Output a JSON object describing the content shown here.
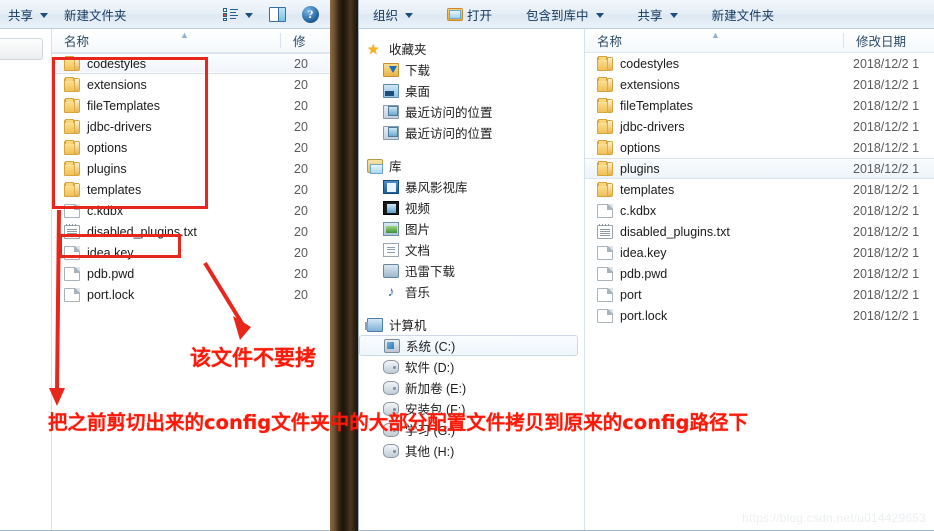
{
  "left_window": {
    "toolbar": {
      "share_label": "共享",
      "new_folder_label": "新建文件夹",
      "views_icon": "views-icon",
      "preview_pane_icon": "preview-pane-icon",
      "help_icon": "help-icon"
    },
    "columns": {
      "name": "名称",
      "date": "修"
    },
    "files": [
      {
        "name": "codestyles",
        "type": "folder",
        "date": "20",
        "state": "focus"
      },
      {
        "name": "extensions",
        "type": "folder",
        "date": "20",
        "state": ""
      },
      {
        "name": "fileTemplates",
        "type": "folder",
        "date": "20",
        "state": ""
      },
      {
        "name": "jdbc-drivers",
        "type": "folder",
        "date": "20",
        "state": ""
      },
      {
        "name": "options",
        "type": "folder",
        "date": "20",
        "state": ""
      },
      {
        "name": "plugins",
        "type": "folder",
        "date": "20",
        "state": ""
      },
      {
        "name": "templates",
        "type": "folder",
        "date": "20",
        "state": ""
      },
      {
        "name": "c.kdbx",
        "type": "file",
        "date": "20",
        "state": ""
      },
      {
        "name": "disabled_plugins.txt",
        "type": "txt",
        "date": "20",
        "state": ""
      },
      {
        "name": "idea.key",
        "type": "file",
        "date": "20",
        "state": ""
      },
      {
        "name": "pdb.pwd",
        "type": "file",
        "date": "20",
        "state": ""
      },
      {
        "name": "port.lock",
        "type": "file",
        "date": "20",
        "state": ""
      }
    ]
  },
  "right_window": {
    "toolbar": {
      "organize_label": "组织",
      "open_label": "打开",
      "include_in_library_label": "包含到库中",
      "share_label": "共享",
      "new_folder_label": "新建文件夹",
      "open_icon": "open-folder-icon"
    },
    "columns": {
      "name": "名称",
      "date": "修改日期"
    },
    "nav": [
      {
        "label": "收藏夹",
        "icon": "star-icon",
        "level": "head",
        "selected": false
      },
      {
        "label": "下载",
        "icon": "download-icon",
        "level": "child",
        "selected": false
      },
      {
        "label": "桌面",
        "icon": "desktop-icon",
        "level": "child",
        "selected": false
      },
      {
        "label": "最近访问的位置",
        "icon": "recent-icon",
        "level": "child",
        "selected": false
      },
      {
        "label": "最近访问的位置",
        "icon": "recent-icon",
        "level": "child",
        "selected": false
      },
      {
        "label": "",
        "icon": "gap",
        "level": "gap",
        "selected": false
      },
      {
        "label": "库",
        "icon": "library-icon",
        "level": "head",
        "selected": false
      },
      {
        "label": "暴风影视库",
        "icon": "baofeng-icon",
        "level": "child",
        "selected": false
      },
      {
        "label": "视频",
        "icon": "video-icon",
        "level": "child",
        "selected": false
      },
      {
        "label": "图片",
        "icon": "picture-icon",
        "level": "child",
        "selected": false
      },
      {
        "label": "文档",
        "icon": "document-icon",
        "level": "child",
        "selected": false
      },
      {
        "label": "迅雷下载",
        "icon": "xunlei-icon",
        "level": "child",
        "selected": false
      },
      {
        "label": "音乐",
        "icon": "music-icon",
        "level": "child",
        "selected": false
      },
      {
        "label": "",
        "icon": "gap",
        "level": "gap",
        "selected": false
      },
      {
        "label": "计算机",
        "icon": "computer-icon",
        "level": "head",
        "selected": false
      },
      {
        "label": "系统 (C:)",
        "icon": "system-drive-icon",
        "level": "child",
        "selected": true
      },
      {
        "label": "软件 (D:)",
        "icon": "drive-icon",
        "level": "child",
        "selected": false
      },
      {
        "label": "新加卷 (E:)",
        "icon": "drive-icon",
        "level": "child",
        "selected": false
      },
      {
        "label": "安装包 (F:)",
        "icon": "drive-icon",
        "level": "child",
        "selected": false
      },
      {
        "label": "学习 (G:)",
        "icon": "drive-icon",
        "level": "child",
        "selected": false
      },
      {
        "label": "其他 (H:)",
        "icon": "drive-icon",
        "level": "child",
        "selected": false
      }
    ],
    "files": [
      {
        "name": "codestyles",
        "type": "folder",
        "date": "2018/12/2 1",
        "state": ""
      },
      {
        "name": "extensions",
        "type": "folder",
        "date": "2018/12/2 1",
        "state": ""
      },
      {
        "name": "fileTemplates",
        "type": "folder",
        "date": "2018/12/2 1",
        "state": ""
      },
      {
        "name": "jdbc-drivers",
        "type": "folder",
        "date": "2018/12/2 1",
        "state": ""
      },
      {
        "name": "options",
        "type": "folder",
        "date": "2018/12/2 1",
        "state": ""
      },
      {
        "name": "plugins",
        "type": "folder",
        "date": "2018/12/2 1",
        "state": "selected"
      },
      {
        "name": "templates",
        "type": "folder",
        "date": "2018/12/2 1",
        "state": ""
      },
      {
        "name": "c.kdbx",
        "type": "file",
        "date": "2018/12/2 1",
        "state": ""
      },
      {
        "name": "disabled_plugins.txt",
        "type": "txt",
        "date": "2018/12/2 1",
        "state": ""
      },
      {
        "name": "idea.key",
        "type": "file",
        "date": "2018/12/2 1",
        "state": ""
      },
      {
        "name": "pdb.pwd",
        "type": "file",
        "date": "2018/12/2 1",
        "state": ""
      },
      {
        "name": "port",
        "type": "file",
        "date": "2018/12/2 1",
        "state": ""
      },
      {
        "name": "port.lock",
        "type": "file",
        "date": "2018/12/2 1",
        "state": ""
      }
    ]
  },
  "annotations": {
    "note_small": "该文件不要拷",
    "note_main": "把之前剪切出来的config文件夹中的大部分配置文件拷贝到原来的config路径下",
    "accent_color": "#fb1a09",
    "box_color": "#e8261c"
  },
  "watermark": "https://blog.csdn.net/u014429653"
}
